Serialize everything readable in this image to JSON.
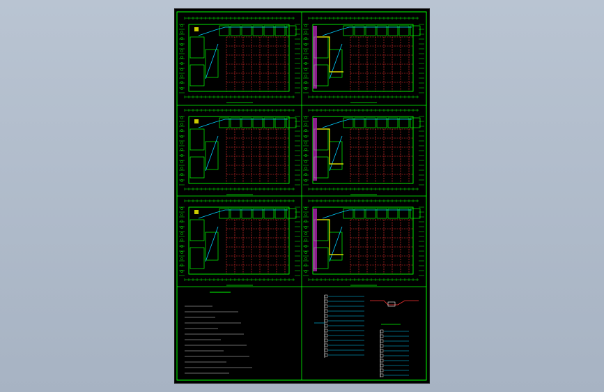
{
  "app": {
    "title": "",
    "theme": {
      "background_top": "#b9c4d2",
      "background_bottom": "#a7b3c3",
      "sheet_background": "#000000",
      "frame_color": "#00ff00",
      "wall_color": "#00ff00",
      "grid_color": "#ff3333",
      "cable_color": "#00cfff",
      "accent_yellow": "#ffff00",
      "accent_magenta": "#ff33ff",
      "text_color": "#ffffff"
    }
  },
  "drawing": {
    "panels": [
      {
        "id": "plan-1",
        "label": ""
      },
      {
        "id": "plan-2",
        "label": ""
      },
      {
        "id": "plan-3",
        "label": ""
      },
      {
        "id": "plan-4",
        "label": ""
      },
      {
        "id": "plan-5",
        "label": ""
      },
      {
        "id": "plan-6",
        "label": ""
      }
    ],
    "notes_title": "",
    "system_title": ""
  }
}
